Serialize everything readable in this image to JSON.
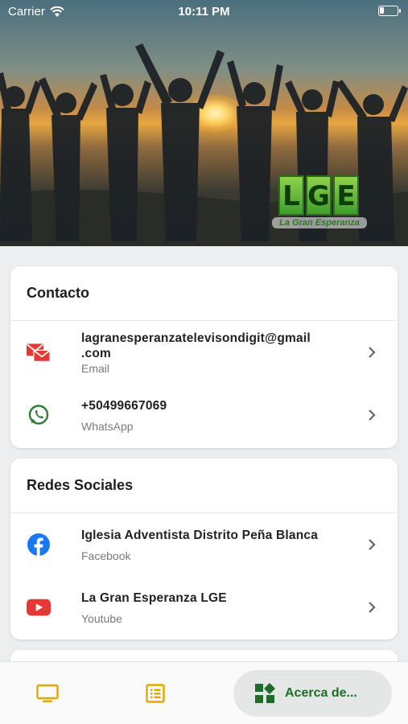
{
  "status_bar": {
    "carrier": "Carrier",
    "time": "10:11 PM",
    "battery_level": 0.25
  },
  "hero": {
    "logo_letters": [
      "L",
      "G",
      "E"
    ],
    "logo_tagline": "La Gran Esperanza"
  },
  "contacto": {
    "title": "Contacto",
    "items": [
      {
        "primary_line1": "lagranesperanzatelevisondigit@gmail",
        "primary_line2": ".com",
        "secondary": "Email",
        "icon": "email-icon"
      },
      {
        "primary_line1": "+50499667069",
        "secondary": "WhatsApp",
        "icon": "whatsapp-icon"
      }
    ]
  },
  "redes": {
    "title": "Redes Sociales",
    "items": [
      {
        "primary_line1": "Iglesia Adventista Distrito Peña Blanca",
        "secondary": "Facebook",
        "icon": "facebook-icon"
      },
      {
        "primary_line1": "La Gran Esperanza LGE",
        "secondary": "Youtube",
        "icon": "youtube-icon"
      }
    ]
  },
  "bottom_nav": {
    "items": [
      {
        "icon": "tv-icon"
      },
      {
        "icon": "list-icon"
      },
      {
        "icon": "widgets-icon",
        "label": "Acerca de...",
        "active": true
      }
    ]
  },
  "colors": {
    "accent_green": "#1f6b2a",
    "nav_icon_yellow": "#e2a800",
    "email_red": "#e53935",
    "whatsapp_green": "#2e7d32",
    "facebook_blue": "#1877f2",
    "youtube_red": "#e53935"
  }
}
